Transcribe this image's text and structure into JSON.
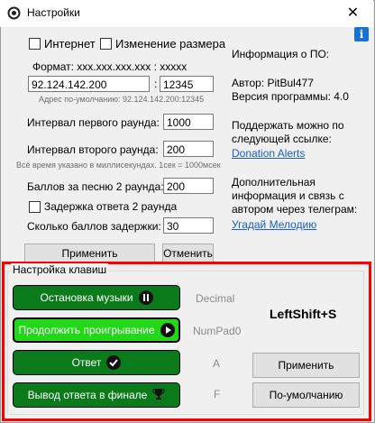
{
  "window": {
    "title": "Настройки",
    "close_label": "✕",
    "info_label": "i"
  },
  "connection": {
    "internet_label": "Интернет",
    "resize_label": "Изменение размера",
    "format_label": "Формат: xxx.xxx.xxx.xxx : xxxxx",
    "ip_value": "92.124.142.200",
    "colon": ":",
    "port_value": "12345",
    "default_hint": "Адрес по-умолчанию: 92.124.142.200:12345"
  },
  "settings": {
    "round1_label": "Интервал первого раунда:",
    "round1_value": "1000",
    "round2_label": "Интервал второго раунда:",
    "round2_value": "200",
    "ms_hint": "Всё время указано в миллисекундах. 1сек = 1000мсек",
    "points_label": "Баллов за песню 2 раунда:",
    "points_value": "200",
    "delay_check_label": "Задержка ответа 2 раунда",
    "delay_points_label": "Сколько баллов задержки:",
    "delay_points_value": "30",
    "apply_label": "Применить",
    "cancel_label": "Отменить"
  },
  "info": {
    "heading": "Информация о ПО:",
    "author": "Автор: PitBul477",
    "version": "Версия программы: 4.0",
    "support_text": "Поддержать можно по следующей ссылке:",
    "donation_link": "Donation Alerts",
    "contact_text": "Дополнительная информация и связь с автором через телеграм:",
    "telegram_link": "Угадай Мелодию"
  },
  "hotkeys": {
    "group_label": "Настройка клавиш",
    "buttons": [
      {
        "label": "Остановка музыки",
        "key": "Decimal",
        "icon": "pause-icon"
      },
      {
        "label": "Продолжить проигрывание",
        "key": "NumPad0",
        "icon": "play-icon"
      },
      {
        "label": "Ответ",
        "key": "A",
        "icon": "check-icon"
      },
      {
        "label": "Вывод ответа в финале",
        "key": "F",
        "icon": "trophy-icon"
      }
    ],
    "current_key": "LeftShift+S",
    "apply_label": "Применить",
    "default_label": "По-умолчанию"
  },
  "colors": {
    "accent_green": "#0b7a1a",
    "active_green": "#22d818",
    "highlight_red": "#ff0000",
    "link_blue": "#1a5fc4"
  }
}
